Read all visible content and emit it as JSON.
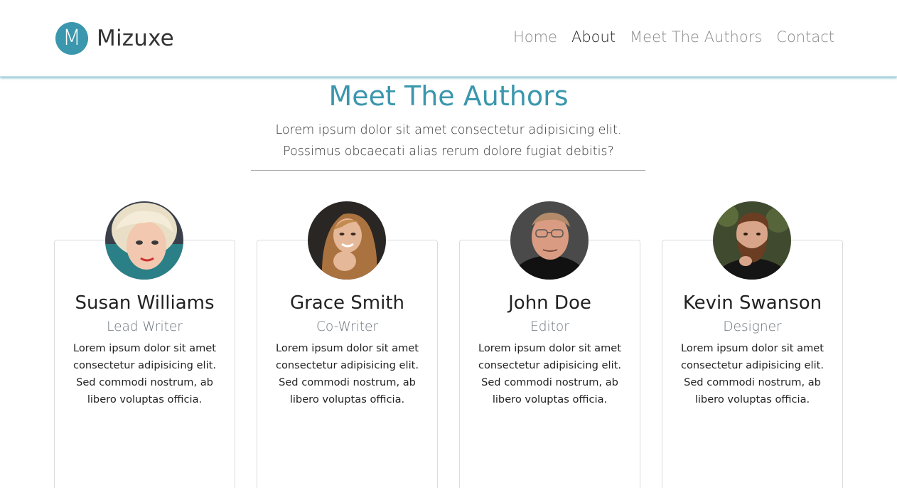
{
  "nav": {
    "logo_letter": "M",
    "brand_name": "Mizuxe",
    "links": [
      {
        "label": "Home",
        "active": false
      },
      {
        "label": "About",
        "active": true
      },
      {
        "label": "Meet The Authors",
        "active": false
      },
      {
        "label": "Contact",
        "active": false
      }
    ]
  },
  "section": {
    "title": "Meet The Authors",
    "lead": "Lorem ipsum dolor sit amet consectetur adipisicing elit. Possimus obcaecati alias rerum dolore fugiat debitis?"
  },
  "authors": [
    {
      "name": "Susan Williams",
      "role": "Lead Writer",
      "bio": "Lorem ipsum dolor sit amet consectetur adipisicing elit. Sed commodi nostrum, ab libero voluptas officia.",
      "avatar_icon": "woman-blonde-portrait-icon"
    },
    {
      "name": "Grace Smith",
      "role": "Co-Writer",
      "bio": "Lorem ipsum dolor sit amet consectetur adipisicing elit. Sed commodi nostrum, ab libero voluptas officia.",
      "avatar_icon": "woman-long-hair-portrait-icon"
    },
    {
      "name": "John Doe",
      "role": "Editor",
      "bio": "Lorem ipsum dolor sit amet consectetur adipisicing elit. Sed commodi nostrum, ab libero voluptas officia.",
      "avatar_icon": "man-glasses-portrait-icon"
    },
    {
      "name": "Kevin Swanson",
      "role": "Designer",
      "bio": "Lorem ipsum dolor sit amet consectetur adipisicing elit. Sed commodi nostrum, ab libero voluptas officia.",
      "avatar_icon": "man-beard-portrait-icon"
    }
  ],
  "colors": {
    "accent": "#3a97ad",
    "muted": "#6c757d",
    "nav_inactive": "#8a8a8a"
  }
}
